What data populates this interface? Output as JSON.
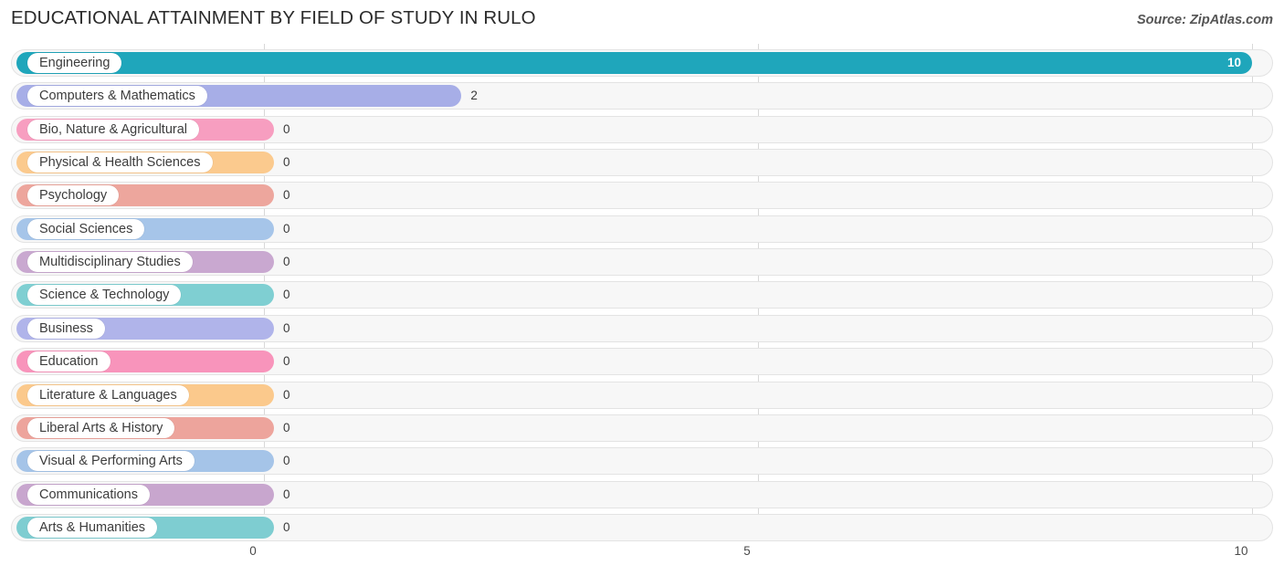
{
  "header": {
    "title": "EDUCATIONAL ATTAINMENT BY FIELD OF STUDY IN RULO",
    "source": "Source: ZipAtlas.com"
  },
  "chart_data": {
    "type": "bar",
    "orientation": "horizontal",
    "title": "EDUCATIONAL ATTAINMENT BY FIELD OF STUDY IN RULO",
    "xlabel": "",
    "ylabel": "",
    "xlim": [
      0,
      10
    ],
    "xticks": [
      "0",
      "5",
      "10"
    ],
    "xtick_values": [
      0,
      5,
      10
    ],
    "grid": true,
    "legend": false,
    "categories": [
      "Engineering",
      "Computers & Mathematics",
      "Bio, Nature & Agricultural",
      "Physical & Health Sciences",
      "Psychology",
      "Social Sciences",
      "Multidisciplinary Studies",
      "Science & Technology",
      "Business",
      "Education",
      "Literature & Languages",
      "Liberal Arts & History",
      "Visual & Performing Arts",
      "Communications",
      "Arts & Humanities"
    ],
    "values": [
      10,
      2,
      0,
      0,
      0,
      0,
      0,
      0,
      0,
      0,
      0,
      0,
      0,
      0,
      0
    ],
    "value_labels": [
      "10",
      "2",
      "0",
      "0",
      "0",
      "0",
      "0",
      "0",
      "0",
      "0",
      "0",
      "0",
      "0",
      "0",
      "0"
    ],
    "colors": [
      "#1fa6bb",
      "#a7aee7",
      "#f79ec0",
      "#fbca8e",
      "#eda69d",
      "#a6c5e9",
      "#c9a8d0",
      "#7fcfd2",
      "#b0b4ea",
      "#f894bb",
      "#fbc98c",
      "#eda49c",
      "#a5c4e8",
      "#c8a6ce",
      "#7ecdd1"
    ]
  }
}
